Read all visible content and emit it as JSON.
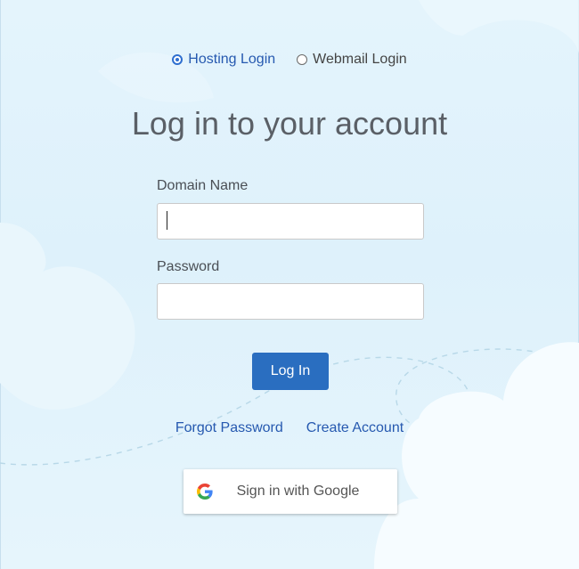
{
  "login_type": {
    "options": [
      {
        "label": "Hosting Login",
        "selected": true
      },
      {
        "label": "Webmail Login",
        "selected": false
      }
    ]
  },
  "title": "Log in to your account",
  "form": {
    "domain_label": "Domain Name",
    "domain_value": "",
    "password_label": "Password",
    "password_value": "",
    "login_button": "Log In"
  },
  "links": {
    "forgot_password": "Forgot Password",
    "create_account": "Create Account"
  },
  "google": {
    "label": "Sign in with Google",
    "icon": "google-g-icon"
  },
  "colors": {
    "accent": "#2a6ec0",
    "link": "#2659b0",
    "background": "#e3f3fb"
  }
}
